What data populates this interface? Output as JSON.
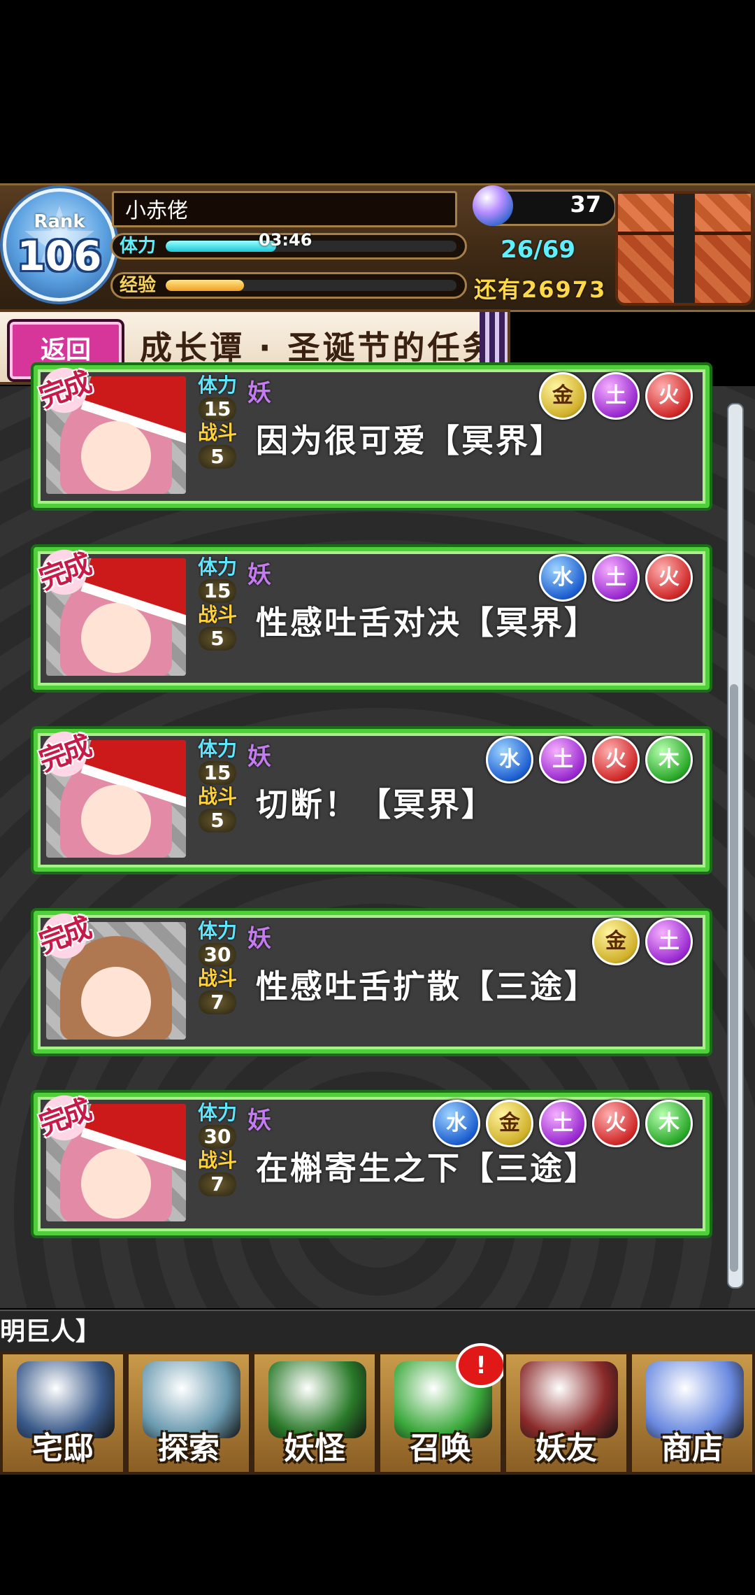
{
  "hud": {
    "rank_label": "Rank",
    "rank_value": "106",
    "player_name": "小赤佬",
    "stamina_label": "体力",
    "stamina_timer": "03:46",
    "stamina_value": "26/69",
    "stamina_fraction": 0.38,
    "exp_label": "经验",
    "exp_remaining": "还有26973",
    "exp_fraction": 0.27,
    "orb_count": "37",
    "chest_icon": "gift-chest-icon"
  },
  "header": {
    "back_label": "返回",
    "title": "成长谭 · 圣诞节的任务"
  },
  "quests": [
    {
      "stamina_label": "体力",
      "stamina": "15",
      "battle_label": "战斗",
      "battles": "5",
      "type": "妖",
      "name": "因为很可爱【冥界】",
      "elements": [
        "metal",
        "earth",
        "fire"
      ],
      "portrait": "santa-girl",
      "complete": "完成"
    },
    {
      "stamina_label": "体力",
      "stamina": "15",
      "battle_label": "战斗",
      "battles": "5",
      "type": "妖",
      "name": "性感吐舌对决【冥界】",
      "elements": [
        "water",
        "earth",
        "fire"
      ],
      "portrait": "santa-girl",
      "complete": "完成"
    },
    {
      "stamina_label": "体力",
      "stamina": "15",
      "battle_label": "战斗",
      "battles": "5",
      "type": "妖",
      "name": "切断！【冥界】",
      "elements": [
        "water",
        "earth",
        "fire",
        "wood"
      ],
      "portrait": "santa-girl",
      "complete": "完成"
    },
    {
      "stamina_label": "体力",
      "stamina": "30",
      "battle_label": "战斗",
      "battles": "7",
      "type": "妖",
      "name": "性感吐舌扩散【三途】",
      "elements": [
        "metal",
        "earth"
      ],
      "portrait": "brown-girl",
      "complete": "完成"
    },
    {
      "stamina_label": "体力",
      "stamina": "30",
      "battle_label": "战斗",
      "battles": "7",
      "type": "妖",
      "name": "在槲寄生之下【三途】",
      "elements": [
        "water",
        "metal",
        "earth",
        "fire",
        "wood"
      ],
      "portrait": "santa-girl",
      "complete": "完成"
    }
  ],
  "element_glyphs": {
    "water": "水",
    "earth": "土",
    "fire": "火",
    "wood": "木",
    "metal": "金"
  },
  "ticker_text": "明巨人】",
  "nav": [
    {
      "label": "宅邸",
      "icon": "mansion-icon",
      "color": "#3a5a8a"
    },
    {
      "label": "探索",
      "icon": "magnifier-icon",
      "color": "#6a9ab0"
    },
    {
      "label": "妖怪",
      "icon": "scroll-icon",
      "color": "#2a7a2a"
    },
    {
      "label": "召唤",
      "icon": "pentagram-icon",
      "color": "#3aa83a",
      "badge": "!"
    },
    {
      "label": "妖友",
      "icon": "fox-girl-icon",
      "color": "#8a2a2a"
    },
    {
      "label": "商店",
      "icon": "crystal-orb-icon",
      "color": "#6a8ae0"
    }
  ]
}
